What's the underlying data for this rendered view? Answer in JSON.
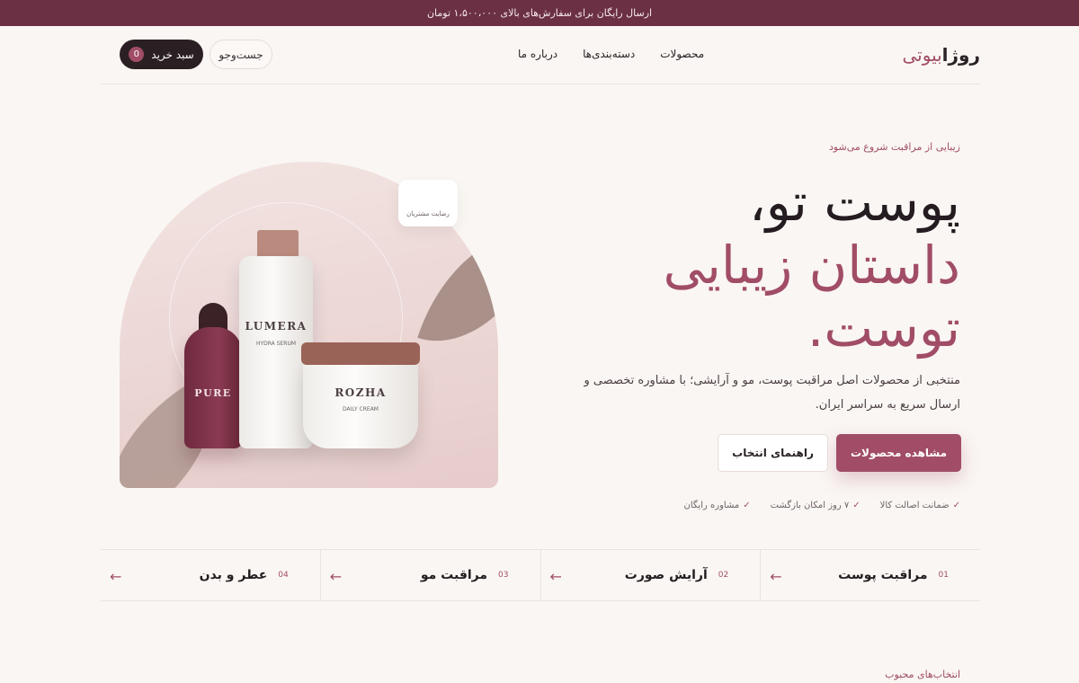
{
  "topbar": {
    "text": "ارسال رایگان برای سفارش‌های بالای ۱،۵۰۰،۰۰۰ تومان"
  },
  "brand": {
    "part1": "روژا",
    "part2": "بیوتی",
    "accent": "#a14d67",
    "dark": "#2a1f22"
  },
  "nav": {
    "items": [
      "محصولات",
      "دسته‌بندی‌ها",
      "درباره ما"
    ],
    "search_label": "جست‌وجو",
    "cart_label": "سبد خرید",
    "cart_count": "0"
  },
  "hero": {
    "eyebrow": "زیبایی از مراقبت شروع می‌شود",
    "title_line1": "پوست تو،",
    "title_line2": "داستان زیبایی",
    "title_line3": "توست.",
    "lead": "منتخبی از محصولات اصل مراقبت پوست، مو و آرایشی؛ با مشاوره تخصصی و ارسال سریع به سراسر ایران.",
    "cta_primary": "مشاهده محصولات",
    "cta_secondary": "راهنمای انتخاب",
    "perks": [
      "ضمانت اصالت کالا",
      "۷ روز امکان بازگشت",
      "مشاوره رایگان"
    ],
    "badge": "رضایت مشتریان",
    "products": {
      "pure": "PURE",
      "lumera": "LUMERA",
      "lumera_sub": "HYDRA SERUM",
      "rozha": "ROZHA",
      "rozha_sub": "DAILY CREAM"
    }
  },
  "categories": [
    {
      "num": "01",
      "name": "مراقبت پوست"
    },
    {
      "num": "02",
      "name": "آرایش صورت"
    },
    {
      "num": "03",
      "name": "مراقبت مو"
    },
    {
      "num": "04",
      "name": "عطر و بدن"
    }
  ],
  "sections": {
    "favorites": "انتخاب‌های محبوب"
  }
}
